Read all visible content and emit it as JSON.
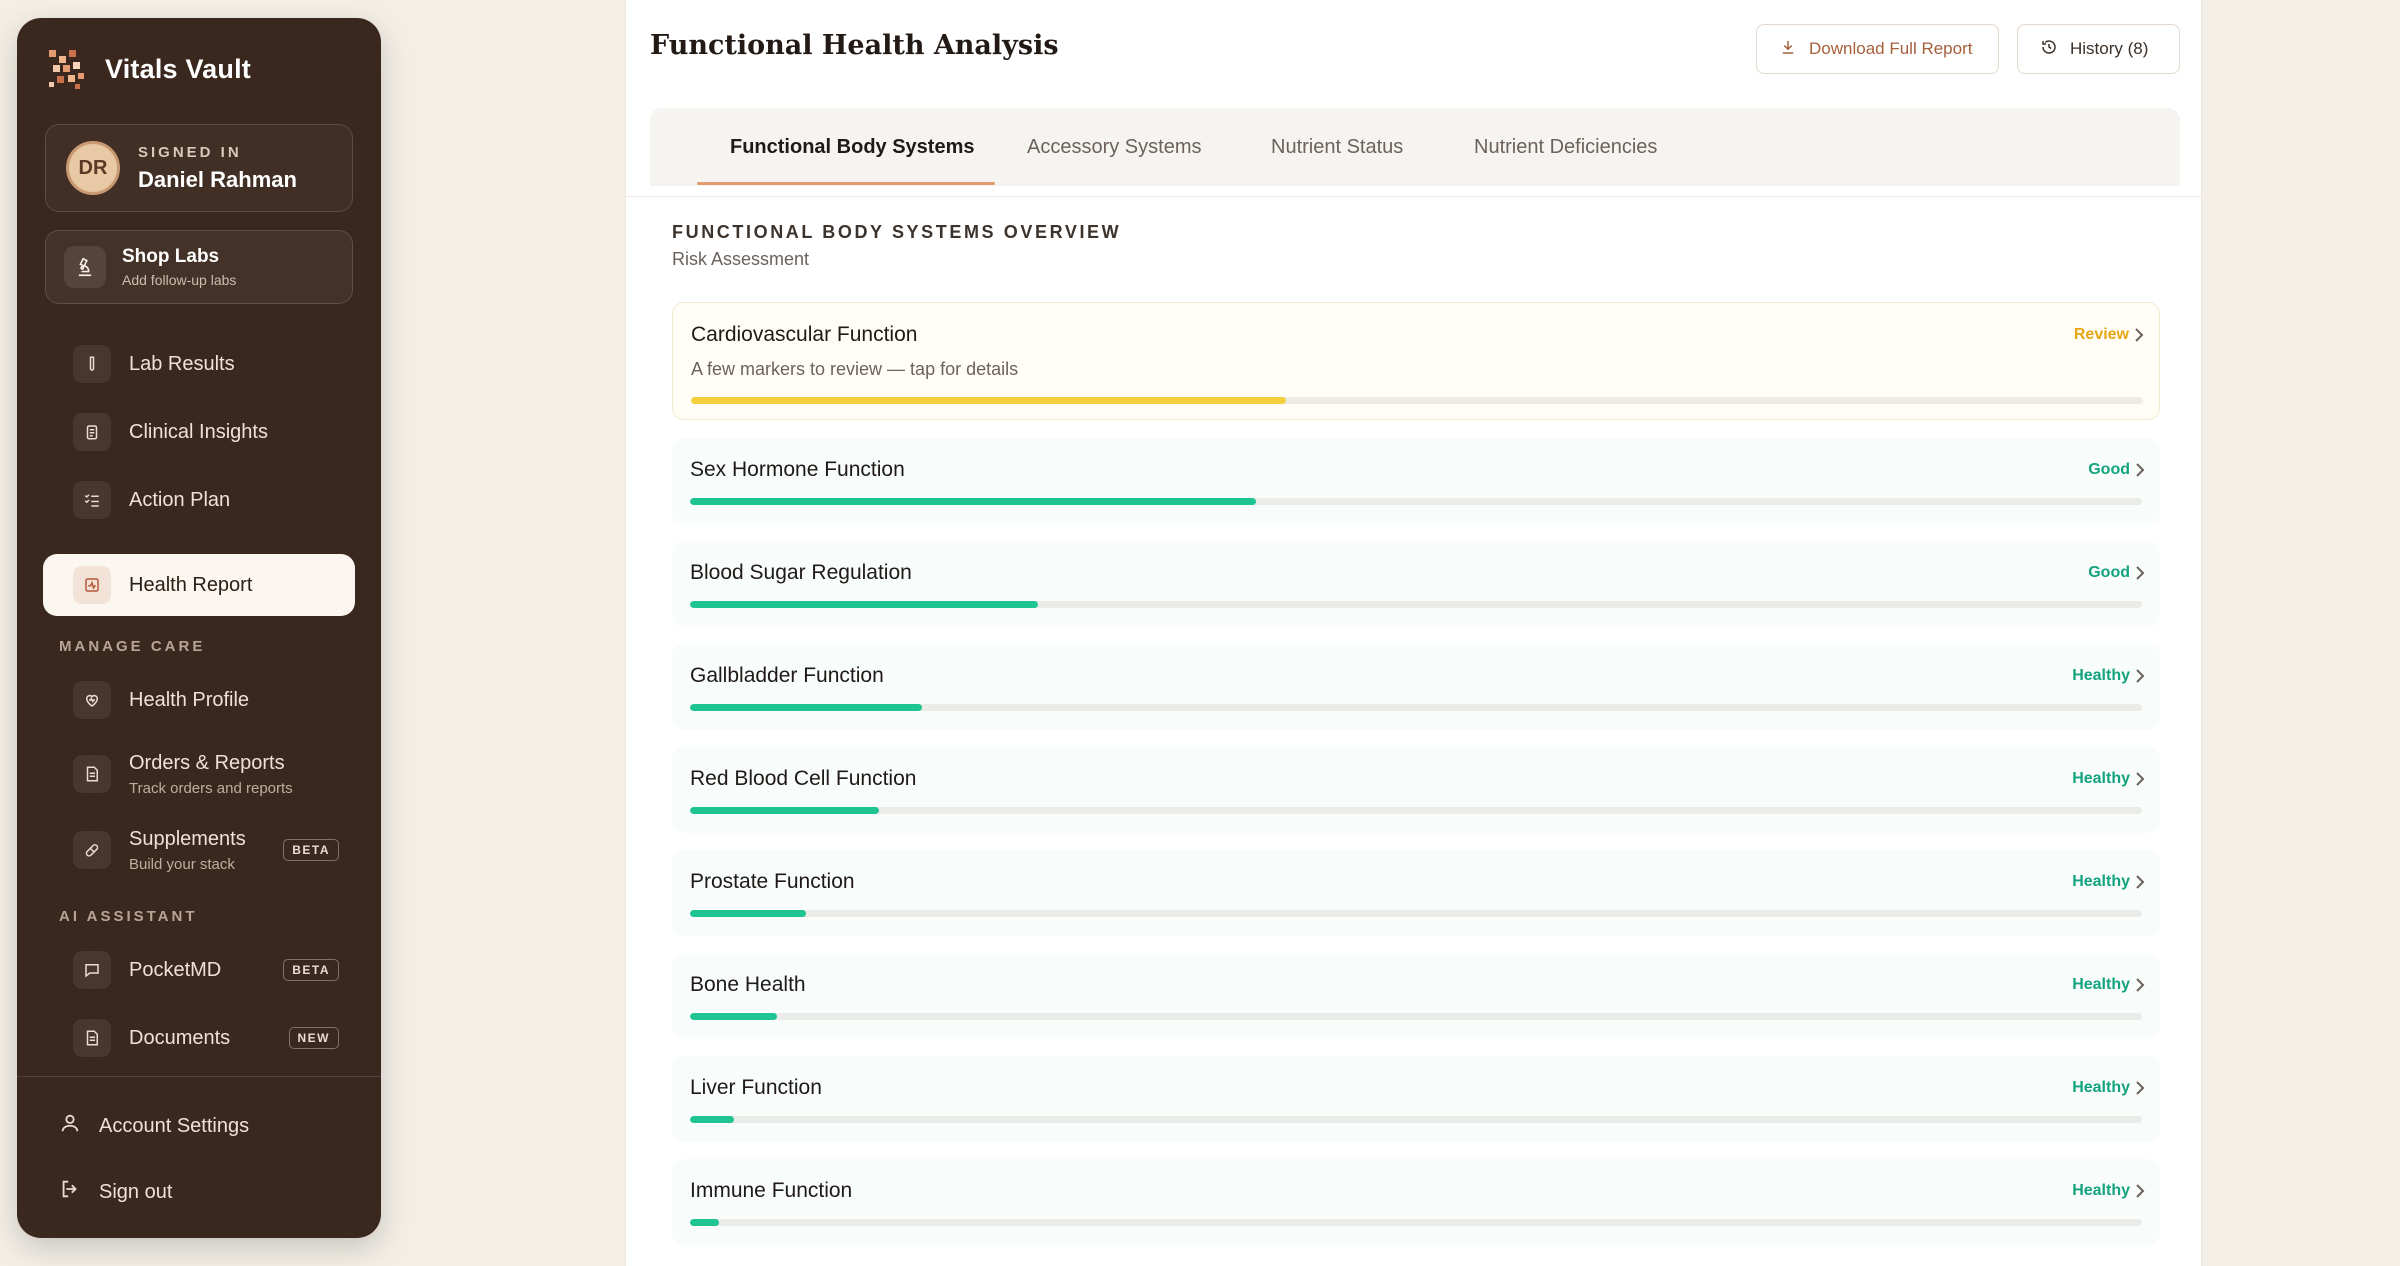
{
  "app": {
    "name": "Vitals Vault",
    "colors": {
      "accent": "#e59a6f",
      "sidebar_bg": "#3a271d",
      "good": "#14a37f",
      "review": "#e5a713"
    }
  },
  "user": {
    "signed_in_label": "SIGNED IN",
    "name": "Daniel Rahman",
    "initials": "DR"
  },
  "shop": {
    "title": "Shop Labs",
    "subtitle": "Add follow-up labs",
    "icon": "microscope-icon"
  },
  "nav": {
    "items": [
      {
        "label": "Lab Results",
        "icon": "test-tube-icon"
      },
      {
        "label": "Clinical Insights",
        "icon": "clipboard-icon"
      },
      {
        "label": "Action Plan",
        "icon": "checklist-icon"
      },
      {
        "label": "Health Report",
        "icon": "activity-report-icon",
        "active": true
      }
    ],
    "manage_care_label": "MANAGE CARE",
    "manage_items": [
      {
        "label": "Health Profile",
        "icon": "heart-pulse-icon"
      },
      {
        "label": "Orders & Reports",
        "subtitle": "Track orders and reports",
        "icon": "document-icon"
      },
      {
        "label": "Supplements",
        "subtitle": "Build your stack",
        "badge": "BETA",
        "icon": "pill-icon"
      }
    ],
    "ai_label": "AI ASSISTANT",
    "ai_items": [
      {
        "label": "PocketMD",
        "badge": "BETA",
        "icon": "chat-icon"
      },
      {
        "label": "Documents",
        "badge": "NEW",
        "icon": "document-icon"
      }
    ],
    "bottom": [
      {
        "label": "Account Settings",
        "icon": "user-icon"
      },
      {
        "label": "Sign out",
        "icon": "sign-out-icon"
      }
    ]
  },
  "header": {
    "title": "Functional Health Analysis",
    "download_label": "Download Full Report",
    "history_label": "History (8)"
  },
  "tabs": [
    {
      "label": "Functional Body Systems",
      "active": true
    },
    {
      "label": "Accessory Systems"
    },
    {
      "label": "Nutrient Status"
    },
    {
      "label": "Nutrient Deficiencies"
    }
  ],
  "overview": {
    "title": "FUNCTIONAL BODY SYSTEMS OVERVIEW",
    "subtitle": "Risk Assessment"
  },
  "systems": [
    {
      "name": "Cardiovascular Function",
      "status": "Review",
      "description": "A few markers to review — tap for details",
      "level": 0.41,
      "color": "#f3cf3b",
      "status_color": "#e5a713"
    },
    {
      "name": "Sex Hormone Function",
      "status": "Good",
      "level": 0.39,
      "color": "#1fc493",
      "status_color": "#14a37f"
    },
    {
      "name": "Blood Sugar Regulation",
      "status": "Good",
      "level": 0.24,
      "color": "#1fc493",
      "status_color": "#14a37f"
    },
    {
      "name": "Gallbladder Function",
      "status": "Healthy",
      "level": 0.16,
      "color": "#1fc493",
      "status_color": "#14a37f"
    },
    {
      "name": "Red Blood Cell Function",
      "status": "Healthy",
      "level": 0.13,
      "color": "#1fc493",
      "status_color": "#14a37f"
    },
    {
      "name": "Prostate Function",
      "status": "Healthy",
      "level": 0.08,
      "color": "#1fc493",
      "status_color": "#14a37f"
    },
    {
      "name": "Bone Health",
      "status": "Healthy",
      "level": 0.06,
      "color": "#1fc493",
      "status_color": "#14a37f"
    },
    {
      "name": "Liver Function",
      "status": "Healthy",
      "level": 0.03,
      "color": "#1fc493",
      "status_color": "#14a37f"
    },
    {
      "name": "Immune Function",
      "status": "Healthy",
      "level": 0.02,
      "color": "#1fc493",
      "status_color": "#14a37f"
    }
  ]
}
